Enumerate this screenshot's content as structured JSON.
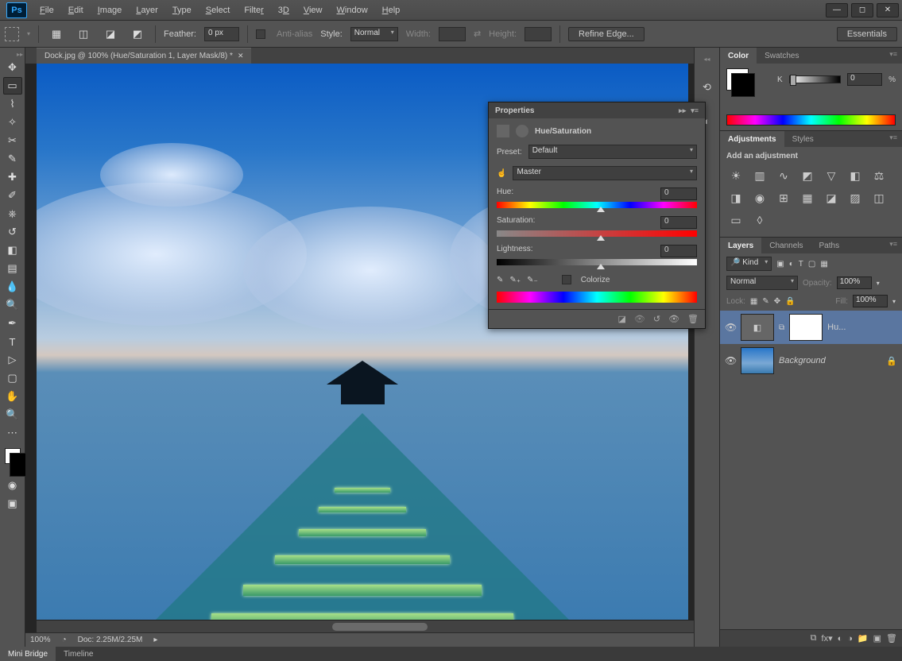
{
  "app": {
    "logo": "Ps"
  },
  "menubar": [
    "File",
    "Edit",
    "Image",
    "Layer",
    "Type",
    "Select",
    "Filter",
    "3D",
    "View",
    "Window",
    "Help"
  ],
  "optionsbar": {
    "feather_label": "Feather:",
    "feather_value": "0 px",
    "antialias_label": "Anti-alias",
    "style_label": "Style:",
    "style_value": "Normal",
    "width_label": "Width:",
    "height_label": "Height:",
    "refine_edge": "Refine Edge...",
    "essentials": "Essentials"
  },
  "document": {
    "tab_title": "Dock.jpg @ 100% (Hue/Saturation 1, Layer Mask/8) *",
    "zoom": "100%",
    "doc_size": "Doc: 2.25M/2.25M"
  },
  "properties": {
    "title": "Properties",
    "subtitle": "Hue/Saturation",
    "preset_label": "Preset:",
    "preset_value": "Default",
    "channel_value": "Master",
    "hue_label": "Hue:",
    "hue_value": "0",
    "sat_label": "Saturation:",
    "sat_value": "0",
    "light_label": "Lightness:",
    "light_value": "0",
    "colorize_label": "Colorize"
  },
  "panels": {
    "color_tab": "Color",
    "swatches_tab": "Swatches",
    "k_label": "K",
    "k_value": "0",
    "k_unit": "%",
    "adjustments_tab": "Adjustments",
    "styles_tab": "Styles",
    "add_adjustment": "Add an adjustment",
    "layers_tab": "Layers",
    "channels_tab": "Channels",
    "paths_tab": "Paths",
    "kind_label": "Kind",
    "blend_mode": "Normal",
    "opacity_label": "Opacity:",
    "opacity_value": "100%",
    "lock_label": "Lock:",
    "fill_label": "Fill:",
    "fill_value": "100%",
    "layer1_name": "Hu...",
    "layer2_name": "Background"
  },
  "bottom_tabs": {
    "mini_bridge": "Mini Bridge",
    "timeline": "Timeline"
  }
}
